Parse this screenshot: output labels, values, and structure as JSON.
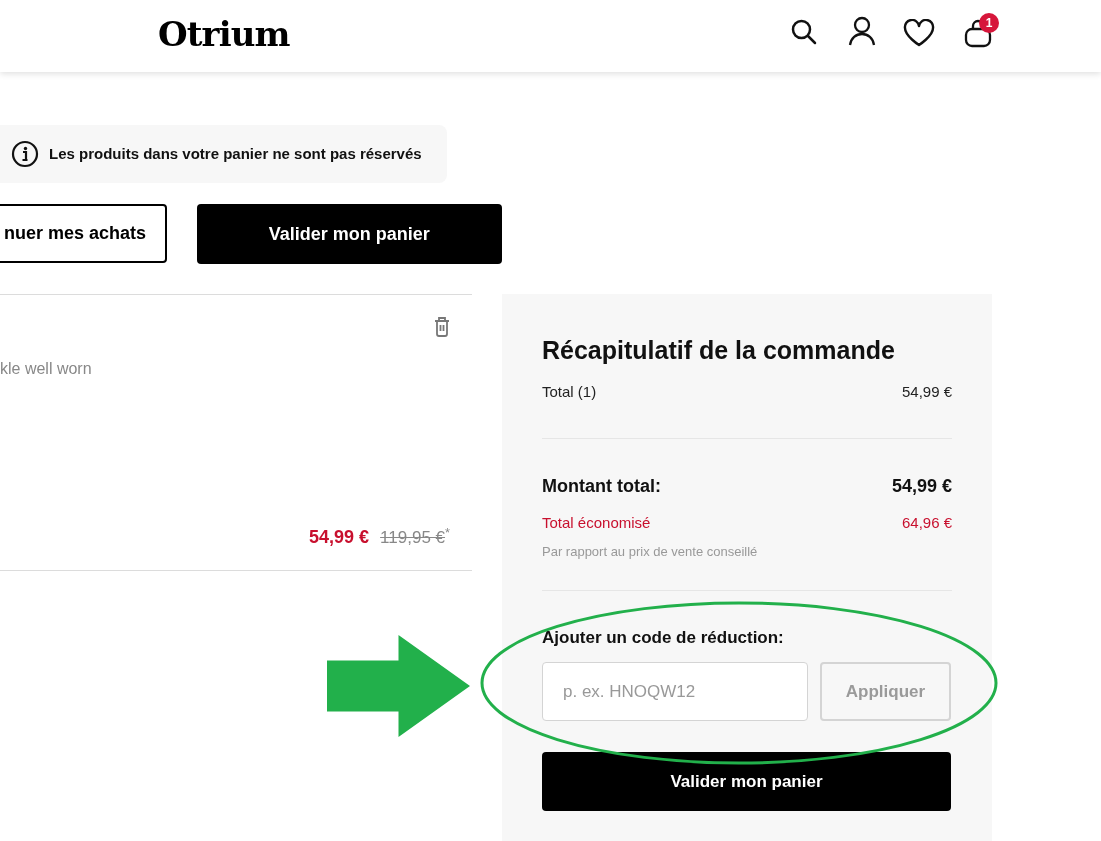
{
  "header": {
    "logo": "Otrium",
    "cart_count": "1"
  },
  "notice": "Les produits dans votre panier ne sont pas réservés",
  "actions": [
    {
      "label": "nuer mes achats",
      "kind": "outline"
    },
    {
      "label": "Valider mon panier",
      "kind": "primary"
    }
  ],
  "item": {
    "description": "kle well worn",
    "price": "54,99 €",
    "original_price": "119,95 €",
    "footnote_mark": "*"
  },
  "summary": {
    "title": "Récapitulatif de la commande",
    "subtotal_label": "Total (1)",
    "subtotal": "54,99 €",
    "total_label": "Montant total:",
    "total": "54,99 €",
    "saved_label": "Total économisé",
    "saved": "64,96 €",
    "saved_note": "Par rapport au prix de vente conseillé",
    "discount_label": "Ajouter un code de réduction:",
    "discount_placeholder": "p. ex. HNOQW12",
    "apply_button": "Appliquer",
    "checkout_button": "Valider mon panier"
  },
  "annotations": [
    {
      "kind": "arrow",
      "color": "#22b04b"
    },
    {
      "kind": "ellipse",
      "color": "#22b04b"
    }
  ]
}
